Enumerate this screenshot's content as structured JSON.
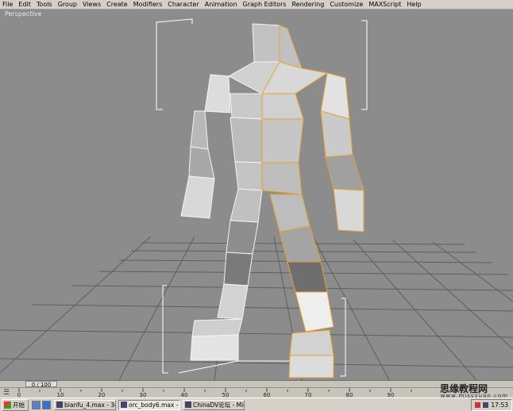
{
  "menu": {
    "items": [
      "File",
      "Edit",
      "Tools",
      "Group",
      "Views",
      "Create",
      "Modifiers",
      "Character",
      "Animation",
      "Graph Editors",
      "Rendering",
      "Customize",
      "MAXScript",
      "Help"
    ]
  },
  "viewport": {
    "label": "Perspective"
  },
  "timeline": {
    "slider_text": "0 / 100",
    "current_frame": 0,
    "total_frames": 100,
    "ticks": [
      "0",
      "10",
      "20",
      "30",
      "40",
      "50",
      "60",
      "70",
      "80",
      "90"
    ]
  },
  "status": {
    "mode_text": "Expert Mod",
    "clock": "17:53"
  },
  "watermark": {
    "title": "思缘教程网",
    "url": "www.missyuan.com"
  },
  "taskbar": {
    "start_label": "开始",
    "tasks": [
      {
        "label": "bianfu_4.max - 3d...",
        "icon": "max-app-icon",
        "active": false
      },
      {
        "label": "orc_body6.max - ...",
        "icon": "max-app-icon",
        "active": true
      },
      {
        "label": "ChinaDV论坛 - Mic...",
        "icon": "browser-icon",
        "active": false
      }
    ]
  },
  "colors": {
    "viewport_bg": "#8c8c8c",
    "grid": "#5a5a5a",
    "mesh_fill": "#c8c8c8",
    "selection": "#e8a030",
    "wire": "#ffffff"
  }
}
